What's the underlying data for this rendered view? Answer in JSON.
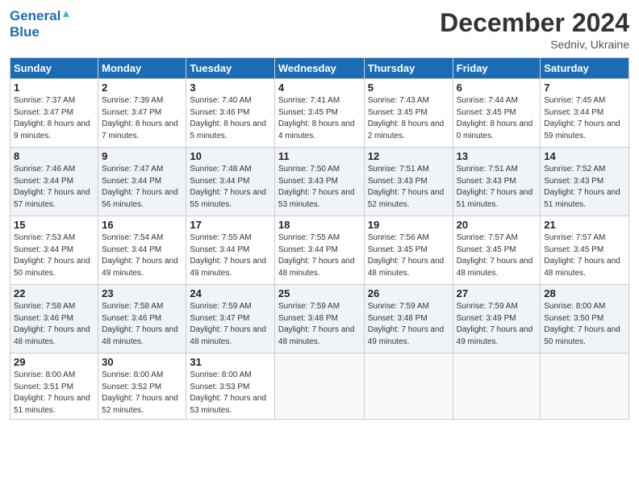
{
  "header": {
    "logo_line1": "General",
    "logo_line2": "Blue",
    "month_year": "December 2024",
    "location": "Sedniv, Ukraine"
  },
  "weekdays": [
    "Sunday",
    "Monday",
    "Tuesday",
    "Wednesday",
    "Thursday",
    "Friday",
    "Saturday"
  ],
  "weeks": [
    [
      {
        "day": "1",
        "sunrise": "7:37 AM",
        "sunset": "3:47 PM",
        "daylight": "8 hours and 9 minutes."
      },
      {
        "day": "2",
        "sunrise": "7:39 AM",
        "sunset": "3:47 PM",
        "daylight": "8 hours and 7 minutes."
      },
      {
        "day": "3",
        "sunrise": "7:40 AM",
        "sunset": "3:46 PM",
        "daylight": "8 hours and 5 minutes."
      },
      {
        "day": "4",
        "sunrise": "7:41 AM",
        "sunset": "3:45 PM",
        "daylight": "8 hours and 4 minutes."
      },
      {
        "day": "5",
        "sunrise": "7:43 AM",
        "sunset": "3:45 PM",
        "daylight": "8 hours and 2 minutes."
      },
      {
        "day": "6",
        "sunrise": "7:44 AM",
        "sunset": "3:45 PM",
        "daylight": "8 hours and 0 minutes."
      },
      {
        "day": "7",
        "sunrise": "7:45 AM",
        "sunset": "3:44 PM",
        "daylight": "7 hours and 59 minutes."
      }
    ],
    [
      {
        "day": "8",
        "sunrise": "7:46 AM",
        "sunset": "3:44 PM",
        "daylight": "7 hours and 57 minutes."
      },
      {
        "day": "9",
        "sunrise": "7:47 AM",
        "sunset": "3:44 PM",
        "daylight": "7 hours and 56 minutes."
      },
      {
        "day": "10",
        "sunrise": "7:48 AM",
        "sunset": "3:44 PM",
        "daylight": "7 hours and 55 minutes."
      },
      {
        "day": "11",
        "sunrise": "7:50 AM",
        "sunset": "3:43 PM",
        "daylight": "7 hours and 53 minutes."
      },
      {
        "day": "12",
        "sunrise": "7:51 AM",
        "sunset": "3:43 PM",
        "daylight": "7 hours and 52 minutes."
      },
      {
        "day": "13",
        "sunrise": "7:51 AM",
        "sunset": "3:43 PM",
        "daylight": "7 hours and 51 minutes."
      },
      {
        "day": "14",
        "sunrise": "7:52 AM",
        "sunset": "3:43 PM",
        "daylight": "7 hours and 51 minutes."
      }
    ],
    [
      {
        "day": "15",
        "sunrise": "7:53 AM",
        "sunset": "3:44 PM",
        "daylight": "7 hours and 50 minutes."
      },
      {
        "day": "16",
        "sunrise": "7:54 AM",
        "sunset": "3:44 PM",
        "daylight": "7 hours and 49 minutes."
      },
      {
        "day": "17",
        "sunrise": "7:55 AM",
        "sunset": "3:44 PM",
        "daylight": "7 hours and 49 minutes."
      },
      {
        "day": "18",
        "sunrise": "7:55 AM",
        "sunset": "3:44 PM",
        "daylight": "7 hours and 48 minutes."
      },
      {
        "day": "19",
        "sunrise": "7:56 AM",
        "sunset": "3:45 PM",
        "daylight": "7 hours and 48 minutes."
      },
      {
        "day": "20",
        "sunrise": "7:57 AM",
        "sunset": "3:45 PM",
        "daylight": "7 hours and 48 minutes."
      },
      {
        "day": "21",
        "sunrise": "7:57 AM",
        "sunset": "3:45 PM",
        "daylight": "7 hours and 48 minutes."
      }
    ],
    [
      {
        "day": "22",
        "sunrise": "7:58 AM",
        "sunset": "3:46 PM",
        "daylight": "7 hours and 48 minutes."
      },
      {
        "day": "23",
        "sunrise": "7:58 AM",
        "sunset": "3:46 PM",
        "daylight": "7 hours and 48 minutes."
      },
      {
        "day": "24",
        "sunrise": "7:59 AM",
        "sunset": "3:47 PM",
        "daylight": "7 hours and 48 minutes."
      },
      {
        "day": "25",
        "sunrise": "7:59 AM",
        "sunset": "3:48 PM",
        "daylight": "7 hours and 48 minutes."
      },
      {
        "day": "26",
        "sunrise": "7:59 AM",
        "sunset": "3:48 PM",
        "daylight": "7 hours and 49 minutes."
      },
      {
        "day": "27",
        "sunrise": "7:59 AM",
        "sunset": "3:49 PM",
        "daylight": "7 hours and 49 minutes."
      },
      {
        "day": "28",
        "sunrise": "8:00 AM",
        "sunset": "3:50 PM",
        "daylight": "7 hours and 50 minutes."
      }
    ],
    [
      {
        "day": "29",
        "sunrise": "8:00 AM",
        "sunset": "3:51 PM",
        "daylight": "7 hours and 51 minutes."
      },
      {
        "day": "30",
        "sunrise": "8:00 AM",
        "sunset": "3:52 PM",
        "daylight": "7 hours and 52 minutes."
      },
      {
        "day": "31",
        "sunrise": "8:00 AM",
        "sunset": "3:53 PM",
        "daylight": "7 hours and 53 minutes."
      },
      null,
      null,
      null,
      null
    ]
  ],
  "labels": {
    "sunrise": "Sunrise:",
    "sunset": "Sunset:",
    "daylight": "Daylight:"
  }
}
